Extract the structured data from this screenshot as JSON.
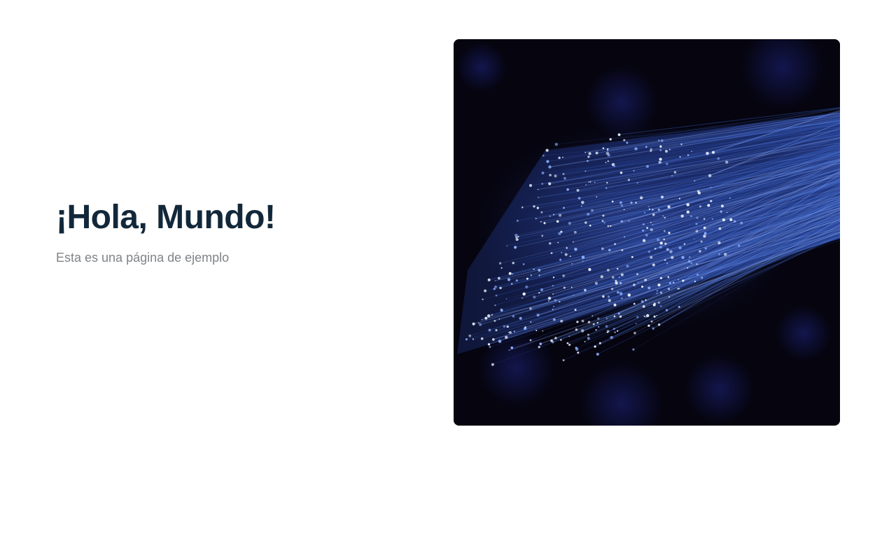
{
  "hero": {
    "title": "¡Hola, Mundo!",
    "subtitle": "Esta es una página de ejemplo"
  },
  "image": {
    "subject": "blue fiber optic cables with glowing tips on dark background",
    "colors": {
      "background": "#05040f",
      "fiber": "#3a63c8",
      "fiber_highlight": "#8fb0ff",
      "tip": "#eaf2ff",
      "bokeh": "#1a1f6e"
    }
  }
}
